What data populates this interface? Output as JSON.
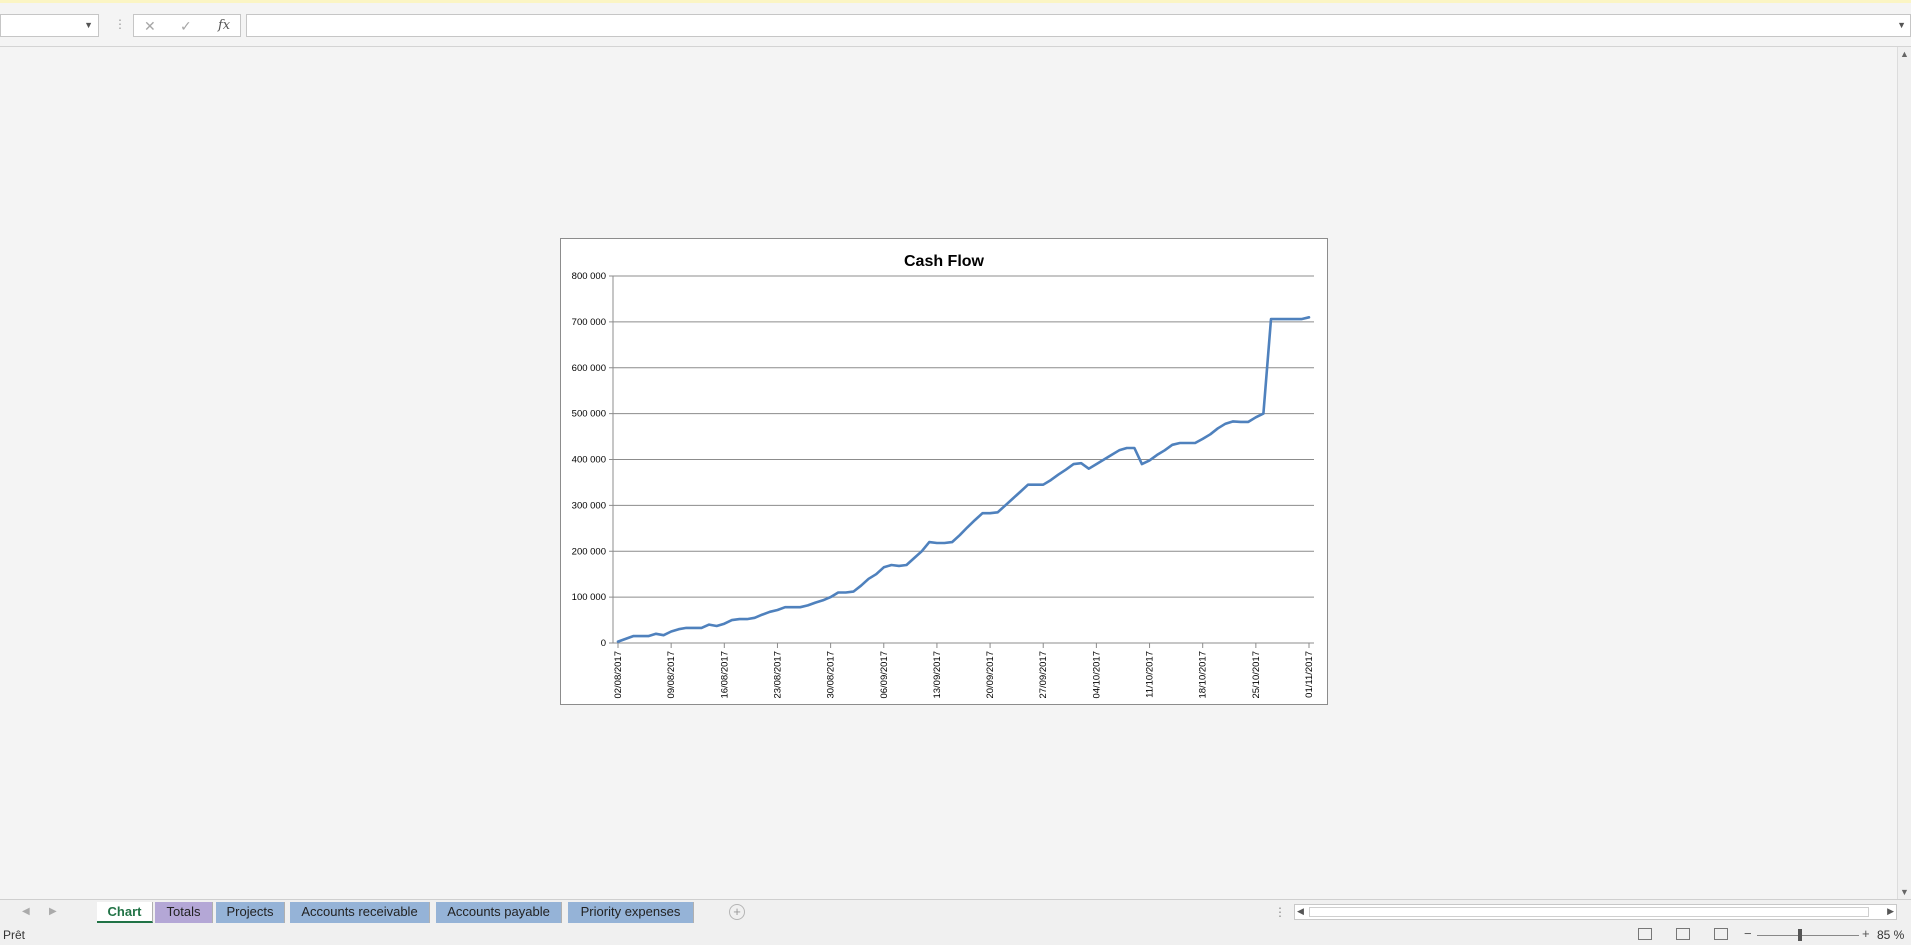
{
  "formula_bar": {
    "cancel_icon": "✕",
    "enter_icon": "✓",
    "fx_label": "fx",
    "name_box_value": "",
    "formula_value": ""
  },
  "sheet_tabs": [
    {
      "label": "Chart",
      "active": true,
      "color": "#ffffff"
    },
    {
      "label": "Totals",
      "active": false,
      "color": "#b4a7d6"
    },
    {
      "label": "Projects",
      "active": false,
      "color": "#95b3d7"
    },
    {
      "label": "Accounts receivable",
      "active": false,
      "color": "#95b3d7"
    },
    {
      "label": "Accounts payable",
      "active": false,
      "color": "#95b3d7"
    },
    {
      "label": "Priority expenses",
      "active": false,
      "color": "#95b3d7"
    }
  ],
  "status": {
    "text": "Prêt",
    "zoom_label": "85 %",
    "zoom_percent": 85
  },
  "chart_data": {
    "type": "line",
    "title": "Cash Flow",
    "xlabel": "",
    "ylabel": "",
    "ylim": [
      0,
      800000
    ],
    "yticks": [
      0,
      100000,
      200000,
      300000,
      400000,
      500000,
      600000,
      700000,
      800000
    ],
    "ytick_labels": [
      "0",
      "100 000",
      "200 000",
      "300 000",
      "400 000",
      "500 000",
      "600 000",
      "700 000",
      "800 000"
    ],
    "xlim": [
      "2017-08-02",
      "2017-11-01"
    ],
    "xtick_labels": [
      "02/08/2017",
      "09/08/2017",
      "16/08/2017",
      "23/08/2017",
      "30/08/2017",
      "06/09/2017",
      "13/09/2017",
      "20/09/2017",
      "27/09/2017",
      "04/10/2017",
      "11/10/2017",
      "18/10/2017",
      "25/10/2017",
      "01/11/2017"
    ],
    "grid": true,
    "line_color": "#4f81bd",
    "series": [
      {
        "x": [
          "2017-08-02",
          "2017-08-04",
          "2017-08-05",
          "2017-08-06",
          "2017-08-07",
          "2017-08-08",
          "2017-08-09",
          "2017-08-10",
          "2017-08-11",
          "2017-08-12",
          "2017-08-13",
          "2017-08-14",
          "2017-08-15",
          "2017-08-16",
          "2017-08-17",
          "2017-08-18",
          "2017-08-19",
          "2017-08-20",
          "2017-08-21",
          "2017-08-22",
          "2017-08-23",
          "2017-08-24",
          "2017-08-25",
          "2017-08-26",
          "2017-08-27",
          "2017-08-28",
          "2017-08-29",
          "2017-08-30",
          "2017-08-31",
          "2017-09-01",
          "2017-09-02",
          "2017-09-03",
          "2017-09-04",
          "2017-09-05",
          "2017-09-06",
          "2017-09-07",
          "2017-09-08",
          "2017-09-09",
          "2017-09-10",
          "2017-09-11",
          "2017-09-12",
          "2017-09-13",
          "2017-09-14",
          "2017-09-15",
          "2017-09-16",
          "2017-09-17",
          "2017-09-18",
          "2017-09-19",
          "2017-09-20",
          "2017-09-21",
          "2017-09-22",
          "2017-09-23",
          "2017-09-24",
          "2017-09-25",
          "2017-09-26",
          "2017-09-27",
          "2017-09-28",
          "2017-09-29",
          "2017-09-30",
          "2017-10-01",
          "2017-10-02",
          "2017-10-03",
          "2017-10-04",
          "2017-10-05",
          "2017-10-06",
          "2017-10-07",
          "2017-10-08",
          "2017-10-09",
          "2017-10-10",
          "2017-10-11",
          "2017-10-12",
          "2017-10-13",
          "2017-10-14",
          "2017-10-15",
          "2017-10-16",
          "2017-10-17",
          "2017-10-18",
          "2017-10-19",
          "2017-10-20",
          "2017-10-21",
          "2017-10-22",
          "2017-10-23",
          "2017-10-24",
          "2017-10-25",
          "2017-10-26",
          "2017-10-27",
          "2017-10-28",
          "2017-10-29",
          "2017-10-30",
          "2017-10-31",
          "2017-11-01"
        ],
        "values": [
          3000,
          15000,
          15000,
          15000,
          20000,
          17000,
          25000,
          30000,
          33000,
          33000,
          33000,
          40000,
          37000,
          42000,
          50000,
          52000,
          52000,
          55000,
          62000,
          68000,
          72000,
          78000,
          78000,
          78000,
          82000,
          88000,
          93000,
          100000,
          110000,
          110000,
          112000,
          125000,
          140000,
          150000,
          165000,
          170000,
          168000,
          170000,
          185000,
          200000,
          220000,
          218000,
          218000,
          220000,
          235000,
          252000,
          268000,
          283000,
          283000,
          285000,
          300000,
          315000,
          330000,
          345000,
          345000,
          345000,
          355000,
          367000,
          378000,
          390000,
          392000,
          380000,
          390000,
          400000,
          410000,
          420000,
          425000,
          425000,
          390000,
          398000,
          410000,
          420000,
          432000,
          436000,
          436000,
          436000,
          445000,
          455000,
          468000,
          478000,
          483000,
          482000,
          482000,
          492000,
          500000,
          706000,
          706000,
          706000,
          706000,
          706000,
          710000
        ]
      }
    ]
  }
}
